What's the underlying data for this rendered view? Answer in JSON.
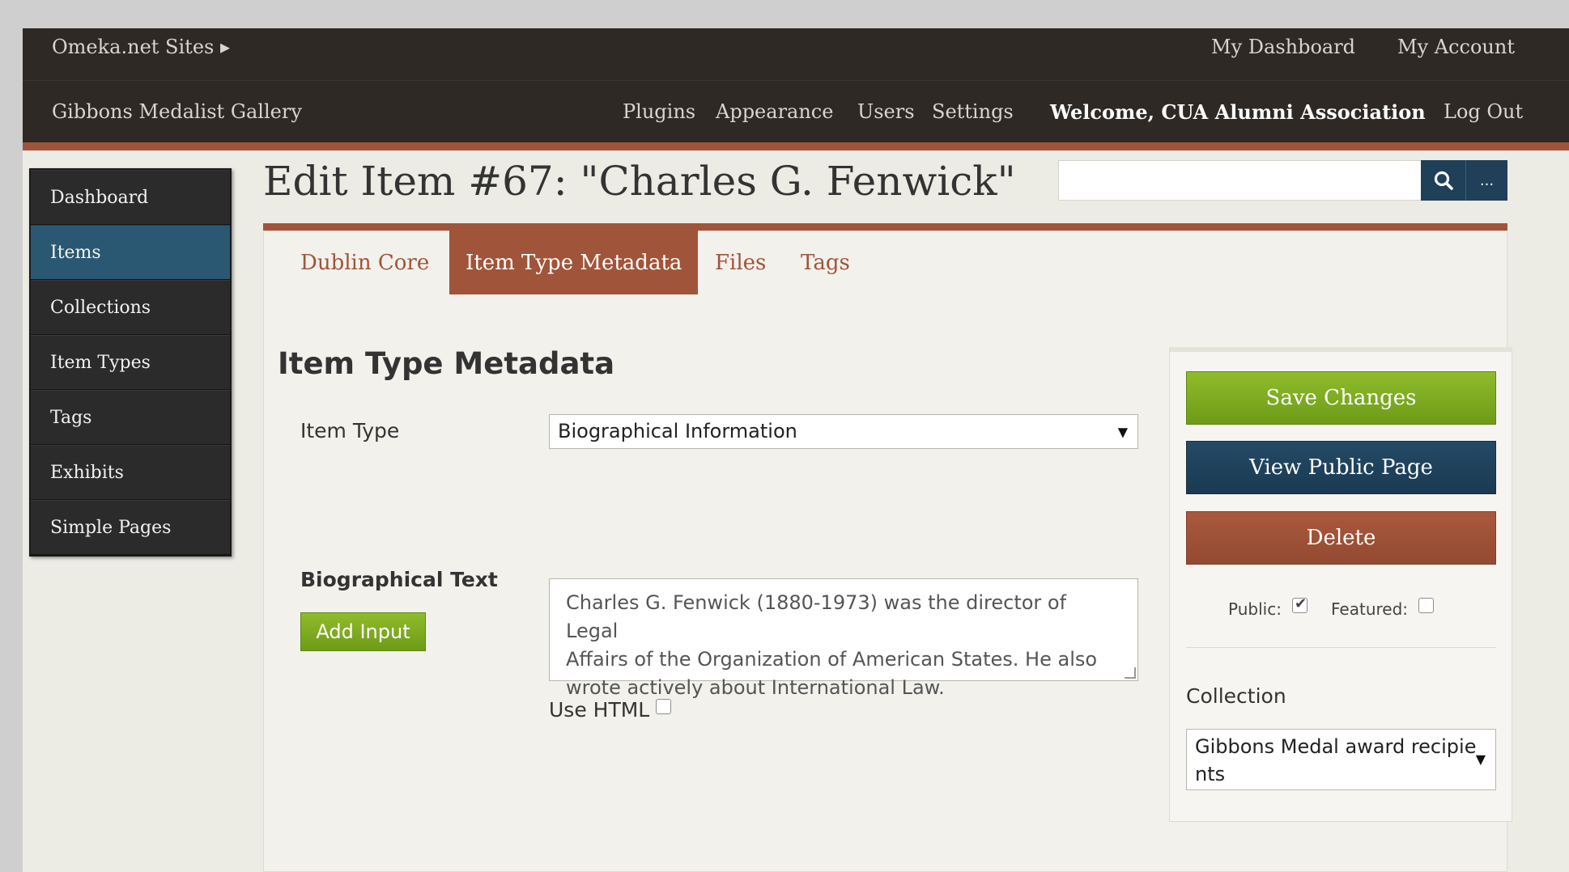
{
  "topbar": {
    "sites_label": "Omeka.net Sites ▸",
    "my_dashboard": "My Dashboard",
    "my_account": "My Account"
  },
  "adminbar": {
    "site_name": "Gibbons Medalist Gallery",
    "nav": [
      "Plugins",
      "Appearance",
      "Users",
      "Settings"
    ],
    "welcome": "Welcome, CUA Alumni Association",
    "logout": "Log Out"
  },
  "sidebar": {
    "items": [
      {
        "label": "Dashboard"
      },
      {
        "label": "Items"
      },
      {
        "label": "Collections"
      },
      {
        "label": "Item Types"
      },
      {
        "label": "Tags"
      },
      {
        "label": "Exhibits"
      },
      {
        "label": "Simple Pages"
      }
    ],
    "active_index": 1
  },
  "page": {
    "title": "Edit Item #67: \"Charles G. Fenwick\""
  },
  "search": {
    "placeholder": "",
    "more_label": "..."
  },
  "tabs": [
    "Dublin Core",
    "Item Type Metadata",
    "Files",
    "Tags"
  ],
  "form": {
    "section_title": "Item Type Metadata",
    "item_type_label": "Item Type",
    "item_type_value": "Biographical Information",
    "bio_label": "Biographical Text",
    "add_input": "Add Input",
    "bio_text_lines": [
      "Charles G. Fenwick (1880-1973) was the director of Legal",
      "Affairs of the Organization of American States. He also",
      "wrote actively about International Law."
    ],
    "use_html_label": "Use HTML"
  },
  "actions": {
    "save": "Save Changes",
    "view_public": "View Public Page",
    "delete": "Delete",
    "public_label": "Public:",
    "public_checked": true,
    "featured_label": "Featured:",
    "featured_checked": false,
    "collection_label": "Collection",
    "collection_value_lines": [
      "Gibbons Medal award recipie",
      "nts"
    ]
  },
  "colors": {
    "accent": "#a0553a",
    "topbar": "#2e2925",
    "active_nav": "#2a5872",
    "save_green": "#7aa61f",
    "view_blue": "#1f4058"
  }
}
